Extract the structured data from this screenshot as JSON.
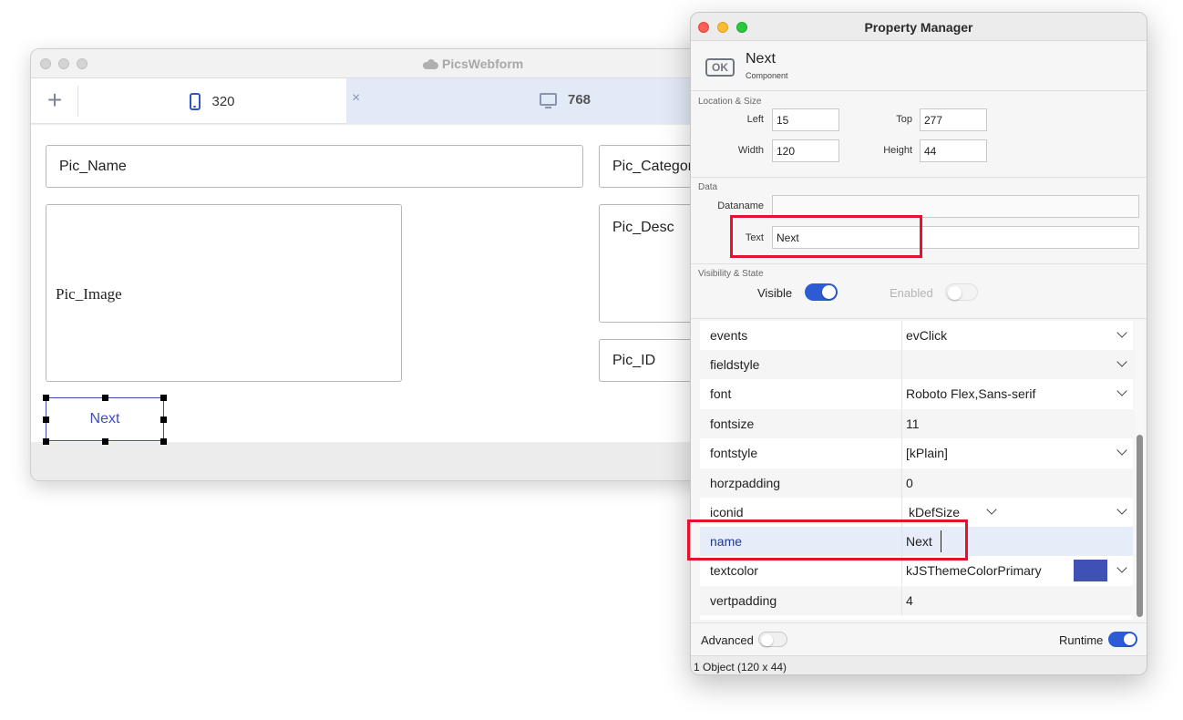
{
  "back_window": {
    "title": "PicsWebform",
    "add_symbol": "+",
    "tabs": [
      {
        "label": "320",
        "icon": "phone-icon"
      },
      {
        "label": "768",
        "icon": "monitor-icon",
        "close_symbol": "×"
      }
    ],
    "fields": {
      "pic_name": "Pic_Name",
      "pic_category": "Pic_Categor",
      "pic_image": "Pic_Image",
      "pic_desc": "Pic_Desc",
      "pic_id": "Pic_ID"
    },
    "next_button": "Next"
  },
  "property_manager": {
    "title": "Property Manager",
    "component": {
      "icon_text": "OK",
      "name": "Next",
      "type": "Component"
    },
    "location_size": {
      "section": "Location & Size",
      "left_label": "Left",
      "left": "15",
      "top_label": "Top",
      "top": "277",
      "width_label": "Width",
      "width": "120",
      "height_label": "Height",
      "height": "44"
    },
    "data": {
      "section": "Data",
      "dataname_label": "Dataname",
      "dataname": "",
      "text_label": "Text",
      "text": "Next"
    },
    "visibility": {
      "section": "Visibility & State",
      "visible_label": "Visible",
      "visible": true,
      "enabled_label": "Enabled",
      "enabled": false
    },
    "properties": [
      {
        "name": "events",
        "value": "evClick",
        "dropdown": true
      },
      {
        "name": "fieldstyle",
        "value": "",
        "dropdown": true
      },
      {
        "name": "font",
        "value": "Roboto Flex,Sans-serif",
        "dropdown": true
      },
      {
        "name": "fontsize",
        "value": "11",
        "dropdown": false
      },
      {
        "name": "fontstyle",
        "value": "[kPlain]",
        "dropdown": true
      },
      {
        "name": "horzpadding",
        "value": "0",
        "dropdown": false
      },
      {
        "name": "iconid",
        "value": "kDefSize",
        "dropdown": true
      },
      {
        "name": "name",
        "value": "Next",
        "dropdown": false,
        "selected": true
      },
      {
        "name": "textcolor",
        "value": "kJSThemeColorPrimary",
        "dropdown": true,
        "swatch": "#3f51b5"
      },
      {
        "name": "vertpadding",
        "value": "4",
        "dropdown": false
      }
    ],
    "footer": {
      "advanced_label": "Advanced",
      "advanced": false,
      "runtime_label": "Runtime",
      "runtime": true
    },
    "status": "1 Object (120 x 44)"
  },
  "colors": {
    "highlight": "#e8112d",
    "accent": "#2d5bd4",
    "primary": "#3f51b5"
  }
}
